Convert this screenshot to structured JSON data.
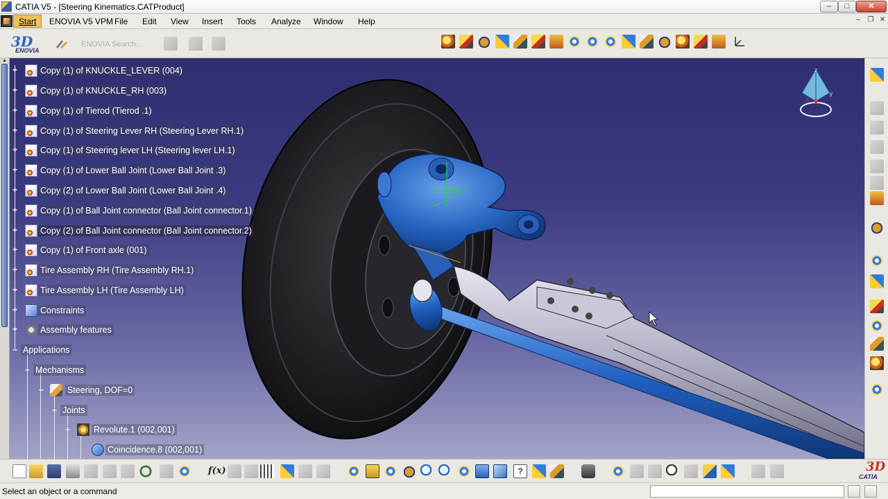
{
  "window": {
    "title": "CATIA V5 - [Steering Kinematics.CATProduct]",
    "controls": {
      "minimize": "–",
      "maximize": "□",
      "close": "✕"
    }
  },
  "menu": {
    "items": [
      "Start",
      "ENOVIA V5 VPM",
      "File",
      "Edit",
      "View",
      "Insert",
      "Tools",
      "Analyze",
      "Window",
      "Help"
    ],
    "doc_controls": {
      "minimize": "–",
      "restore": "❐",
      "close": "✕"
    }
  },
  "top_toolbar": {
    "logo_text": "ENOVIA",
    "search_placeholder": "ENOVIA Search..."
  },
  "tree": {
    "items": [
      {
        "label": "Copy (1) of KNUCKLE_LEVER (004)",
        "icon": "part-icon"
      },
      {
        "label": "Copy (1) of KNUCKLE_RH (003)",
        "icon": "part-icon"
      },
      {
        "label": "Copy (1) of Tierod  (Tierod .1)",
        "icon": "part-icon"
      },
      {
        "label": "Copy (1) of Steering Lever RH (Steering Lever RH.1)",
        "icon": "part-icon"
      },
      {
        "label": "Copy (1) of Steering lever LH (Steering lever LH.1)",
        "icon": "part-icon"
      },
      {
        "label": "Copy (1) of Lower Ball Joint  (Lower Ball Joint .3)",
        "icon": "part-icon"
      },
      {
        "label": "Copy (2) of Lower Ball Joint  (Lower Ball Joint .4)",
        "icon": "part-icon"
      },
      {
        "label": "Copy (1) of Ball Joint connector (Ball Joint connector.1)",
        "icon": "part-icon"
      },
      {
        "label": "Copy (2) of Ball Joint connector (Ball Joint connector.2)",
        "icon": "part-icon"
      },
      {
        "label": "Copy (1) of Front axle (001)",
        "icon": "part-icon"
      },
      {
        "label": "Tire Assembly RH (Tire Assembly RH.1)",
        "icon": "part-icon"
      },
      {
        "label": "Tire Assembly LH (Tire Assembly LH)",
        "icon": "part-icon"
      },
      {
        "label": "Constraints",
        "icon": "constraints-icon"
      },
      {
        "label": "Assembly features",
        "icon": "assembly-features-icon"
      }
    ],
    "applications": "Applications",
    "mechanisms": "Mechanisms",
    "steering": "Steering, DOF=0",
    "joints": "Joints",
    "revolute": "Revolute.1 (002,001)",
    "coincidence": "Coincidence.8 (002,001)"
  },
  "viewport": {
    "dimension_value": "-162,685",
    "compass_axes": {
      "x": "x",
      "y": "y",
      "z": "z"
    }
  },
  "bottom_toolbar": {
    "logo_text": "CATIA"
  },
  "status": {
    "message": "Select an object or a command",
    "command_input_value": ""
  },
  "colors": {
    "viewport_top": "#2f2e71",
    "viewport_bottom": "#a3a3c8",
    "part_highlight": "#2563b8",
    "tree_text": "#ffffff",
    "start_menu_highlight": "#f0c060"
  }
}
